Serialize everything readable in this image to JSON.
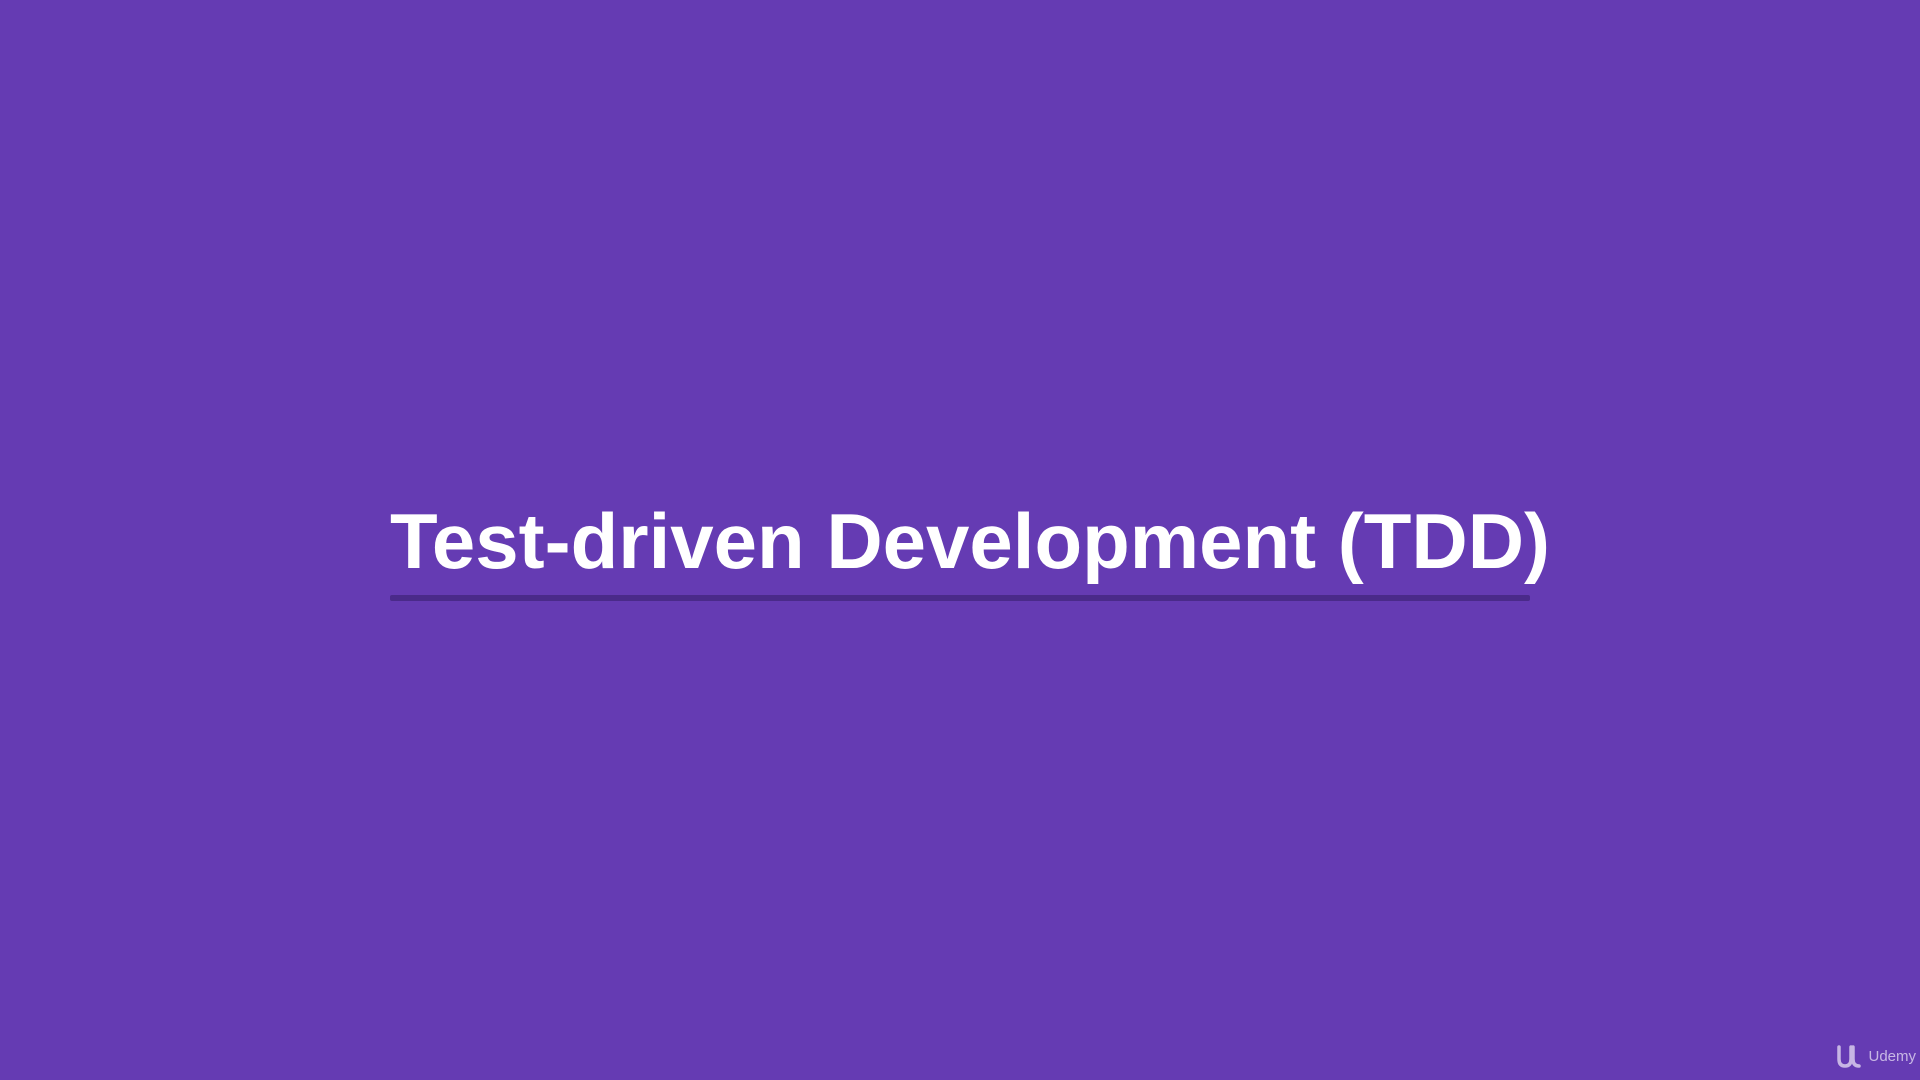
{
  "slide": {
    "title": "Test-driven Development (TDD)",
    "background_color": "#653bb3",
    "underline_color": "#4a2a8a"
  },
  "watermark": {
    "icon": "udemy-logo-icon",
    "label": "Udemy"
  }
}
